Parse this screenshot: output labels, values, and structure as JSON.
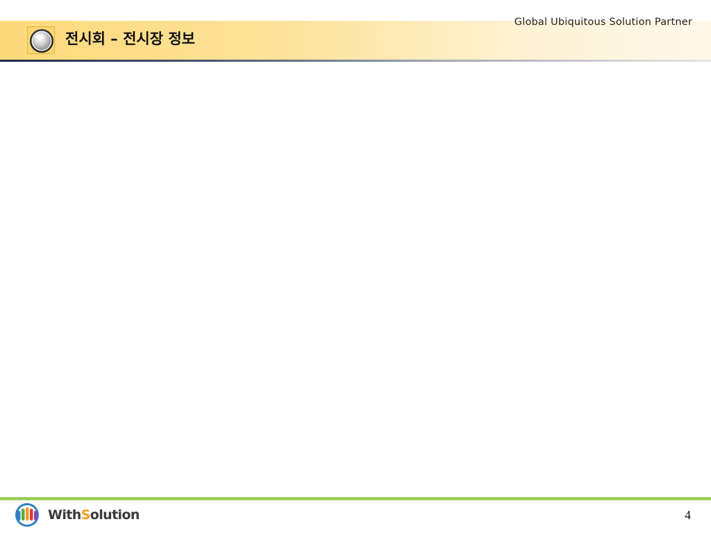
{
  "slide": {
    "title": "전시회 – 전시장 정보",
    "tagline": "Global Ubiquitous Solution Partner",
    "page_number": "4"
  },
  "logo": {
    "text_prefix": "With",
    "text_highlight": "S",
    "text_suffix": "olution"
  },
  "icons": {
    "title_bullet": "round-button-icon",
    "logo_mark": "withsolution-logo-icon"
  },
  "colors": {
    "header_band": "#fdd97a",
    "header_underline": "#1f2a44",
    "footer_line": "#8cc63f",
    "logo_accent": "#f39c1f"
  }
}
